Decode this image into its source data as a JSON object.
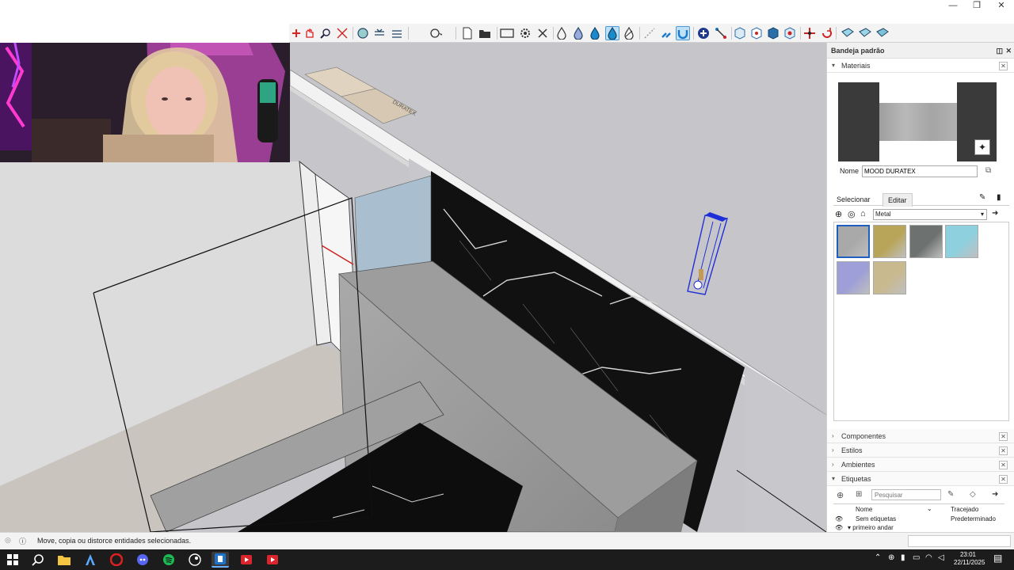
{
  "window": {
    "minimize": "—",
    "restore": "❐",
    "close": "✕"
  },
  "tray": {
    "title": "Bandeja padrão",
    "materials": {
      "section_label": "Materiais",
      "name_label": "Nome",
      "name_value": "MOOD DURATEX",
      "tab_select": "Selecionar",
      "tab_edit": "Editar",
      "library_value": "Metal",
      "swatch_colors": [
        "#a9a9a9",
        "#b9a559",
        "#6d7270",
        "#8fd0df",
        "#9e9ed8",
        "#c8b98f"
      ]
    },
    "sections": [
      "Componentes",
      "Estilos",
      "Ambientes",
      "Etiquetas"
    ],
    "tags": {
      "search_placeholder": "Pesquisar",
      "col_name": "Nome",
      "col_dash": "Tracejado",
      "rows": [
        {
          "name": "Sem etiquetas",
          "dash": "Predeterminado"
        },
        {
          "name": "▾ primeiro andar",
          "dash": ""
        }
      ]
    }
  },
  "status": {
    "message": "Move, copia ou distorce entidades selecionadas."
  },
  "taskbar": {
    "time": "23:01",
    "date": "22/11/2025"
  },
  "scene": {
    "label_text": "DURATEX"
  }
}
